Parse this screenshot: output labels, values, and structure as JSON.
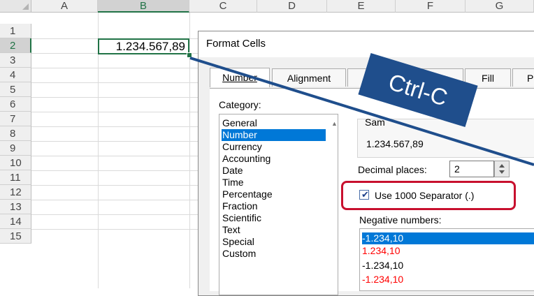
{
  "spreadsheet": {
    "columns": [
      "A",
      "B",
      "C",
      "D",
      "E",
      "F",
      "G"
    ],
    "rows": [
      "1",
      "2",
      "3",
      "4",
      "5",
      "6",
      "7",
      "8",
      "9",
      "10",
      "11",
      "12",
      "13",
      "14",
      "15"
    ],
    "selected_cell_value": "1.234.567,89"
  },
  "dialog": {
    "title": "Format Cells",
    "tabs": [
      "Number",
      "Alignment",
      "",
      "Border",
      "Fill",
      "P"
    ],
    "category_label": "Category:",
    "categories": [
      "General",
      "Number",
      "Currency",
      "Accounting",
      "Date",
      "Time",
      "Percentage",
      "Fraction",
      "Scientific",
      "Text",
      "Special",
      "Custom"
    ],
    "selected_category": "Number",
    "sample_label": "Sam",
    "sample_value": "1.234.567,89",
    "decimal_label": "Decimal places:",
    "decimal_value": "2",
    "separator_label": "Use 1000 Separator (.)",
    "separator_checked": true,
    "negative_label": "Negative numbers:",
    "negative_options": [
      {
        "text": "-1.234,10",
        "color": "#ffffff",
        "selected": true
      },
      {
        "text": "1.234,10",
        "color": "#ff0000",
        "selected": false
      },
      {
        "text": "-1.234,10",
        "color": "#000000",
        "selected": false
      },
      {
        "text": "-1.234,10",
        "color": "#ff0000",
        "selected": false
      }
    ]
  },
  "annotation": {
    "label": "Ctrl-C",
    "color": "#1f4e8c",
    "highlight_color": "#c8102e"
  }
}
